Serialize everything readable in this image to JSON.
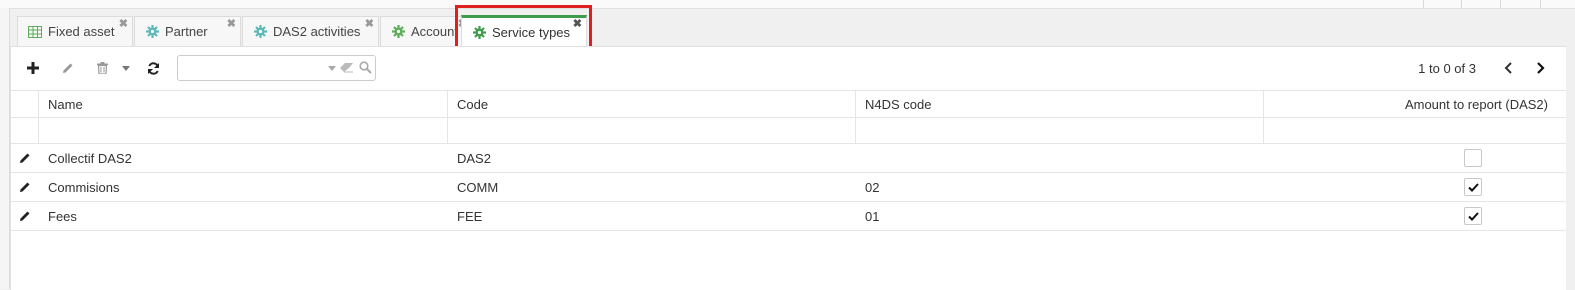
{
  "tabs": [
    {
      "label": "Fixed asset",
      "icon": "table-grid-icon"
    },
    {
      "label": "Partner",
      "icon": "gear-icon"
    },
    {
      "label": "DAS2 activities",
      "icon": "gear-icon"
    },
    {
      "label": "Account",
      "icon": "gear-icon"
    },
    {
      "label": "Service types",
      "icon": "gear-icon",
      "active": true
    }
  ],
  "toolbar": {
    "add_icon": "plus-icon",
    "edit_icon": "pencil-icon",
    "delete_icon": "trash-icon",
    "refresh_icon": "refresh-icon",
    "search_placeholder": ""
  },
  "pager": {
    "text": "1 to 0 of 3"
  },
  "columns": [
    "Name",
    "Code",
    "N4DS code",
    "Amount to report (DAS2)"
  ],
  "rows": [
    {
      "name": "Collectif DAS2",
      "code": "DAS2",
      "n4ds": "",
      "amount_to_report": false
    },
    {
      "name": "Commisions",
      "code": "COMM",
      "n4ds": "02",
      "amount_to_report": true
    },
    {
      "name": "Fees",
      "code": "FEE",
      "n4ds": "01",
      "amount_to_report": true
    }
  ],
  "colors": {
    "accent": "#3e9c4a",
    "highlight": "#e02020",
    "tab_icon_green": "#5cae5c",
    "tab_icon_teal": "#5fb8b8"
  }
}
